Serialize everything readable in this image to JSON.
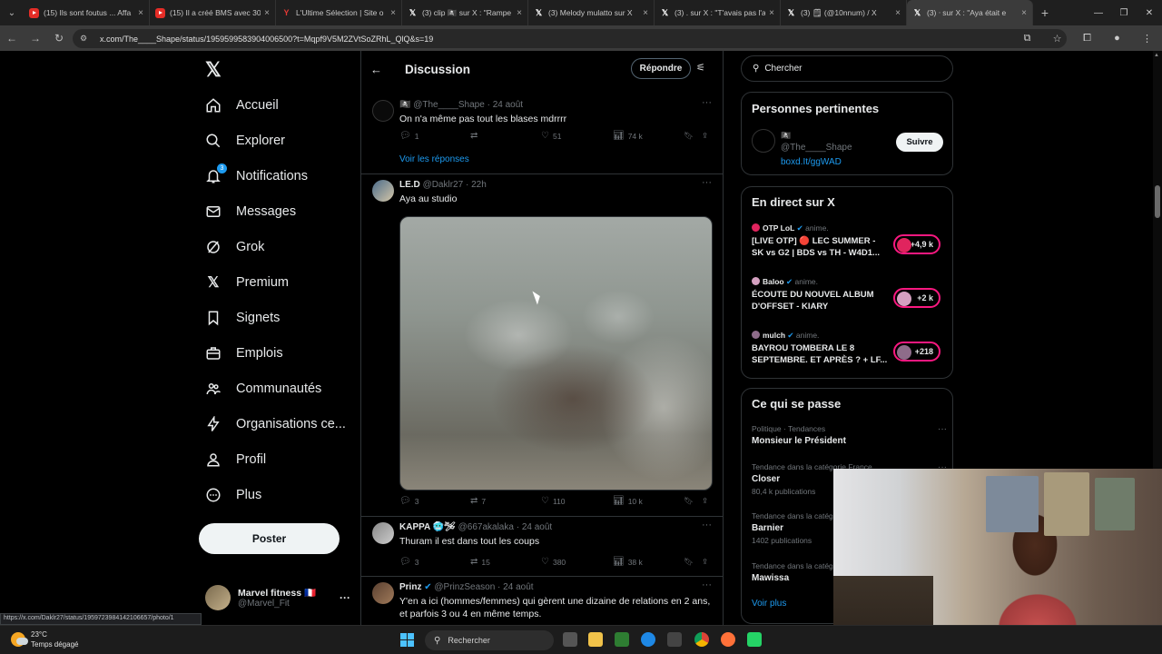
{
  "browser": {
    "tabs": [
      {
        "label": "(15) Ils sont foutus ... Affa",
        "icon": "youtube"
      },
      {
        "label": "(15) Il a créé BMS avec 30",
        "icon": "youtube"
      },
      {
        "label": "L'Ultime Sélection | Site o",
        "icon": "ultime"
      },
      {
        "label": "(3) clip 🏴‍☠️ sur X : \"Rampe",
        "icon": "x"
      },
      {
        "label": "(3) Melody mulatto sur X",
        "icon": "x"
      },
      {
        "label": "(3) . sur X : \"T'avais pas l'a",
        "icon": "x"
      },
      {
        "label": "(3) 🗒 (@10nnum) / X",
        "icon": "x"
      },
      {
        "label": "(3) ᐧ sur X : \"Aya était e",
        "icon": "x",
        "active": true
      }
    ],
    "url": "x.com/The____Shape/status/1959599583904006500?t=Mqpf9V5M2ZVtSoZRhL_QlQ&s=19",
    "status_url": "https://x.com/Daklr27/status/1959723984142106657/photo/1"
  },
  "nav": {
    "logo": "𝕏",
    "items": [
      {
        "label": "Accueil",
        "icon": "home-icon"
      },
      {
        "label": "Explorer",
        "icon": "search-icon"
      },
      {
        "label": "Notifications",
        "icon": "bell-icon",
        "badge": "3"
      },
      {
        "label": "Messages",
        "icon": "mail-icon"
      },
      {
        "label": "Grok",
        "icon": "grok-icon"
      },
      {
        "label": "Premium",
        "icon": "x-premium-icon"
      },
      {
        "label": "Signets",
        "icon": "bookmark-icon"
      },
      {
        "label": "Emplois",
        "icon": "briefcase-icon"
      },
      {
        "label": "Communautés",
        "icon": "people-icon"
      },
      {
        "label": "Organisations ce...",
        "icon": "lightning-icon"
      },
      {
        "label": "Profil",
        "icon": "person-icon"
      },
      {
        "label": "Plus",
        "icon": "more-circle-icon"
      }
    ],
    "post_button": "Poster",
    "account": {
      "name": "Marvel fitness 🇫🇷",
      "handle": "@Marvel_Fit"
    }
  },
  "header": {
    "title": "Discussion",
    "reply_button": "Répondre"
  },
  "tweets": [
    {
      "name": "🏴‍☠️",
      "handle": "@The____Shape",
      "time": "24 août",
      "text": "On n'a même pas tout les blases mdrrrr",
      "replies": "1",
      "reposts": "",
      "likes": "51",
      "views": "74 k",
      "see_replies": "Voir les réponses"
    },
    {
      "name": "LE.D",
      "handle": "@Daklr27",
      "time": "22h",
      "text": "Aya au studio",
      "replies": "3",
      "reposts": "7",
      "likes": "110",
      "views": "10 k"
    },
    {
      "name": "KAPPA 🥶🛩",
      "handle": "@667akalaka",
      "time": "24 août",
      "text": "Thuram il est dans tout les coups",
      "replies": "3",
      "reposts": "15",
      "likes": "380",
      "views": "38 k"
    },
    {
      "name": "Prinz",
      "handle": "@PrinzSeason",
      "time": "24 août",
      "text": "Y'en a ici (hommes/femmes) qui gèrent une dizaine de relations en 2 ans, et parfois 3 ou 4 en même temps."
    }
  ],
  "search": {
    "placeholder": "Chercher"
  },
  "relevant": {
    "title": "Personnes pertinentes",
    "person": {
      "name": "🏴‍☠️",
      "handle": "@The____Shape",
      "link": "boxd.It/ggWAD",
      "follow": "Suivre"
    }
  },
  "live": {
    "title": "En direct sur X",
    "items": [
      {
        "host": "OTP LoL",
        "status": "anime.",
        "title": "[LIVE OTP] 🔴 LEC SUMMER - SK vs G2 | BDS vs TH - W4D1...",
        "count": "+4,9 k",
        "color": "#e0245e"
      },
      {
        "host": "Baloo",
        "status": "anime.",
        "title": "ÉCOUTE DU NOUVEL ALBUM D'OFFSET - KIARY",
        "count": "+2 k",
        "color": "#d4a0c0"
      },
      {
        "host": "mulch",
        "status": "anime.",
        "title": "BAYROU TOMBERA LE 8 SEPTEMBRE. ET APRÈS ? + LF...",
        "count": "+218",
        "color": "#8e6c8a"
      }
    ]
  },
  "trends": {
    "title": "Ce qui se passe",
    "items": [
      {
        "category": "Politique · Tendances",
        "name": "Monsieur le Président",
        "posts": ""
      },
      {
        "category": "Tendance dans la catégorie France",
        "name": "Closer",
        "posts": "80,4 k publications"
      },
      {
        "category": "Tendance dans la catég",
        "name": "Barnier",
        "posts": "1402 publications"
      },
      {
        "category": "Tendance dans la catég",
        "name": "Mawissa",
        "posts": ""
      }
    ],
    "see_more": "Voir plus"
  },
  "taskbar": {
    "temp": "23°C",
    "weather": "Temps dégagé",
    "search": "Rechercher"
  }
}
